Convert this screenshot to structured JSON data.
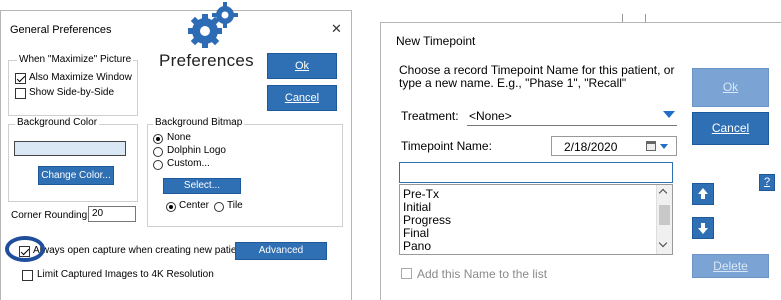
{
  "prefs": {
    "title": "General Preferences",
    "close_glyph": "✕",
    "heading": "Preferences",
    "ok_label": "Ok",
    "cancel_label": "Cancel",
    "maximize_group_title": "When \"Maximize\" Picture",
    "also_maximize_label": "Also Maximize Window",
    "side_by_side_label": "Show Side-by-Side",
    "bg_color_group_title": "Background Color",
    "bg_color_value": "#d9e8f4",
    "change_color_label": "Change Color...",
    "bg_bitmap_group_title": "Background Bitmap",
    "bitmap_options": [
      "None",
      "Dolphin Logo",
      "Custom..."
    ],
    "select_label": "Select...",
    "center_label": "Center",
    "tile_label": "Tile",
    "corner_rounding_label": "Corner Rounding:",
    "corner_rounding_value": "20",
    "always_open_label": "Always open capture when creating new patient",
    "advanced_settings_label": "Advanced Settings...",
    "limit_4k_label": "Limit Captured Images to 4K Resolution"
  },
  "timepoint": {
    "title": "New Timepoint",
    "instructions_line1": "Choose a record Timepoint Name for this patient, or",
    "instructions_line2": "type a new name.  E.g., \"Phase 1\", \"Recall\"",
    "treatment_label": "Treatment:",
    "treatment_value": "<None>",
    "timepoint_name_label": "Timepoint Name:",
    "date_value": "2/18/2020",
    "name_input_value": "",
    "list_items": [
      "Pre-Tx",
      "Initial",
      "Progress",
      "Final",
      "Pano"
    ],
    "add_to_list_label": "Add this Name to the list",
    "ok_label": "Ok",
    "cancel_label": "Cancel",
    "help_label": "?",
    "delete_label": "Delete"
  },
  "colors": {
    "button_blue": "#2f6fb3",
    "highlight_circle": "#1f4e9c",
    "dropdown_arrow": "#1f6fc4"
  }
}
